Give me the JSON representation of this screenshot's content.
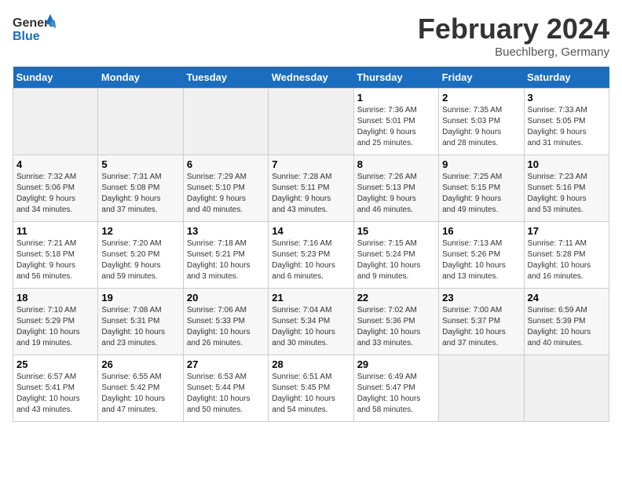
{
  "header": {
    "logo_line1": "General",
    "logo_line2": "Blue",
    "month_title": "February 2024",
    "location": "Buechlberg, Germany"
  },
  "weekdays": [
    "Sunday",
    "Monday",
    "Tuesday",
    "Wednesday",
    "Thursday",
    "Friday",
    "Saturday"
  ],
  "weeks": [
    [
      {
        "day": "",
        "info": ""
      },
      {
        "day": "",
        "info": ""
      },
      {
        "day": "",
        "info": ""
      },
      {
        "day": "",
        "info": ""
      },
      {
        "day": "1",
        "info": "Sunrise: 7:36 AM\nSunset: 5:01 PM\nDaylight: 9 hours\nand 25 minutes."
      },
      {
        "day": "2",
        "info": "Sunrise: 7:35 AM\nSunset: 5:03 PM\nDaylight: 9 hours\nand 28 minutes."
      },
      {
        "day": "3",
        "info": "Sunrise: 7:33 AM\nSunset: 5:05 PM\nDaylight: 9 hours\nand 31 minutes."
      }
    ],
    [
      {
        "day": "4",
        "info": "Sunrise: 7:32 AM\nSunset: 5:06 PM\nDaylight: 9 hours\nand 34 minutes."
      },
      {
        "day": "5",
        "info": "Sunrise: 7:31 AM\nSunset: 5:08 PM\nDaylight: 9 hours\nand 37 minutes."
      },
      {
        "day": "6",
        "info": "Sunrise: 7:29 AM\nSunset: 5:10 PM\nDaylight: 9 hours\nand 40 minutes."
      },
      {
        "day": "7",
        "info": "Sunrise: 7:28 AM\nSunset: 5:11 PM\nDaylight: 9 hours\nand 43 minutes."
      },
      {
        "day": "8",
        "info": "Sunrise: 7:26 AM\nSunset: 5:13 PM\nDaylight: 9 hours\nand 46 minutes."
      },
      {
        "day": "9",
        "info": "Sunrise: 7:25 AM\nSunset: 5:15 PM\nDaylight: 9 hours\nand 49 minutes."
      },
      {
        "day": "10",
        "info": "Sunrise: 7:23 AM\nSunset: 5:16 PM\nDaylight: 9 hours\nand 53 minutes."
      }
    ],
    [
      {
        "day": "11",
        "info": "Sunrise: 7:21 AM\nSunset: 5:18 PM\nDaylight: 9 hours\nand 56 minutes."
      },
      {
        "day": "12",
        "info": "Sunrise: 7:20 AM\nSunset: 5:20 PM\nDaylight: 9 hours\nand 59 minutes."
      },
      {
        "day": "13",
        "info": "Sunrise: 7:18 AM\nSunset: 5:21 PM\nDaylight: 10 hours\nand 3 minutes."
      },
      {
        "day": "14",
        "info": "Sunrise: 7:16 AM\nSunset: 5:23 PM\nDaylight: 10 hours\nand 6 minutes."
      },
      {
        "day": "15",
        "info": "Sunrise: 7:15 AM\nSunset: 5:24 PM\nDaylight: 10 hours\nand 9 minutes."
      },
      {
        "day": "16",
        "info": "Sunrise: 7:13 AM\nSunset: 5:26 PM\nDaylight: 10 hours\nand 13 minutes."
      },
      {
        "day": "17",
        "info": "Sunrise: 7:11 AM\nSunset: 5:28 PM\nDaylight: 10 hours\nand 16 minutes."
      }
    ],
    [
      {
        "day": "18",
        "info": "Sunrise: 7:10 AM\nSunset: 5:29 PM\nDaylight: 10 hours\nand 19 minutes."
      },
      {
        "day": "19",
        "info": "Sunrise: 7:08 AM\nSunset: 5:31 PM\nDaylight: 10 hours\nand 23 minutes."
      },
      {
        "day": "20",
        "info": "Sunrise: 7:06 AM\nSunset: 5:33 PM\nDaylight: 10 hours\nand 26 minutes."
      },
      {
        "day": "21",
        "info": "Sunrise: 7:04 AM\nSunset: 5:34 PM\nDaylight: 10 hours\nand 30 minutes."
      },
      {
        "day": "22",
        "info": "Sunrise: 7:02 AM\nSunset: 5:36 PM\nDaylight: 10 hours\nand 33 minutes."
      },
      {
        "day": "23",
        "info": "Sunrise: 7:00 AM\nSunset: 5:37 PM\nDaylight: 10 hours\nand 37 minutes."
      },
      {
        "day": "24",
        "info": "Sunrise: 6:59 AM\nSunset: 5:39 PM\nDaylight: 10 hours\nand 40 minutes."
      }
    ],
    [
      {
        "day": "25",
        "info": "Sunrise: 6:57 AM\nSunset: 5:41 PM\nDaylight: 10 hours\nand 43 minutes."
      },
      {
        "day": "26",
        "info": "Sunrise: 6:55 AM\nSunset: 5:42 PM\nDaylight: 10 hours\nand 47 minutes."
      },
      {
        "day": "27",
        "info": "Sunrise: 6:53 AM\nSunset: 5:44 PM\nDaylight: 10 hours\nand 50 minutes."
      },
      {
        "day": "28",
        "info": "Sunrise: 6:51 AM\nSunset: 5:45 PM\nDaylight: 10 hours\nand 54 minutes."
      },
      {
        "day": "29",
        "info": "Sunrise: 6:49 AM\nSunset: 5:47 PM\nDaylight: 10 hours\nand 58 minutes."
      },
      {
        "day": "",
        "info": ""
      },
      {
        "day": "",
        "info": ""
      }
    ]
  ]
}
